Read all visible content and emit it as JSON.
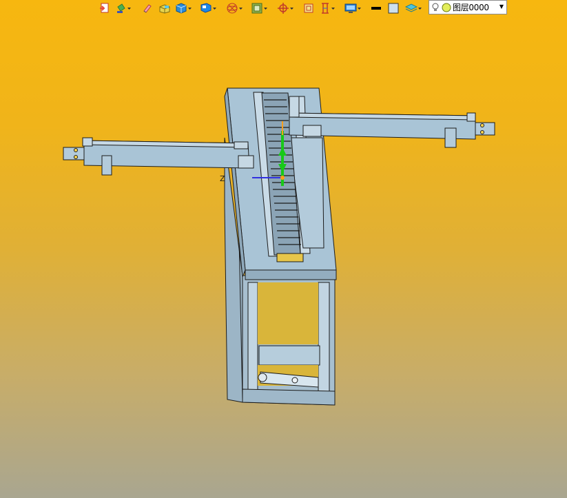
{
  "toolbar": {
    "layer_value": "图层0000",
    "buttons": [
      {
        "name": "import-icon"
      },
      {
        "name": "paint-bucket-icon"
      },
      {
        "name": "eraser-icon"
      },
      {
        "name": "box-solid-icon"
      },
      {
        "name": "blue-cube-icon"
      },
      {
        "name": "view-cube-icon"
      },
      {
        "name": "wireframe-sphere-icon"
      },
      {
        "name": "render-style-icon"
      },
      {
        "name": "snap-target-icon"
      },
      {
        "name": "frame-icon"
      },
      {
        "name": "measure-icon"
      },
      {
        "name": "display-icon"
      },
      {
        "name": "line-color-icon"
      },
      {
        "name": "fill-color-icon"
      },
      {
        "name": "layer-stack-icon"
      }
    ]
  },
  "colors": {
    "model_fill": "#a9c4d6",
    "model_stroke": "#1b1b1b",
    "background_top": "#f7b70f",
    "background_bottom": "#a9a690",
    "axis_y": "#18c918",
    "axis_z": "#3030e0"
  },
  "axis_labels": {
    "z": "Z"
  }
}
